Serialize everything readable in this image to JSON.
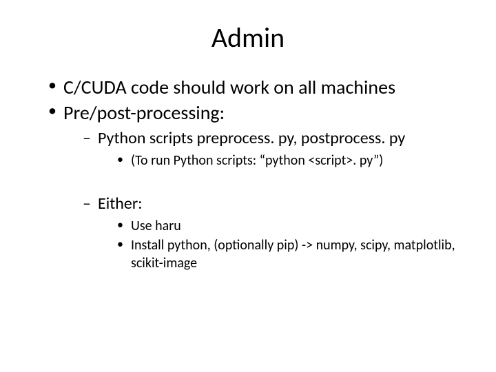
{
  "title": "Admin",
  "bullets": {
    "b1": "C/CUDA code should work on all machines",
    "b2": "Pre/post-processing:",
    "b2_1": "Python scripts preprocess. py, postprocess. py",
    "b2_1_1": "(To run Python scripts: “python <script>. py”)",
    "b2_2": "Either:",
    "b2_2_1": "Use haru",
    "b2_2_2": "Install python, (optionally pip) -> numpy, scipy, matplotlib, scikit-image"
  }
}
